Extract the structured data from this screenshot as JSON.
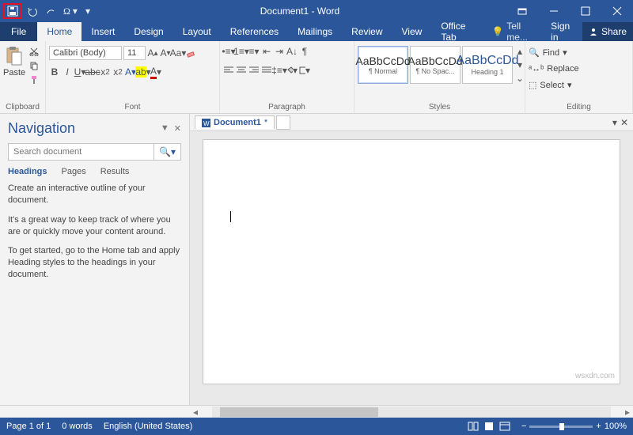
{
  "titlebar": {
    "title": "Document1 - Word"
  },
  "tabs": {
    "file": "File",
    "items": [
      "Home",
      "Insert",
      "Design",
      "Layout",
      "References",
      "Mailings",
      "Review",
      "View",
      "Office Tab"
    ],
    "active": "Home",
    "tell": "Tell me...",
    "signin": "Sign in",
    "share": "Share"
  },
  "ribbon": {
    "clipboard": {
      "paste": "Paste",
      "label": "Clipboard"
    },
    "font": {
      "name": "Calibri (Body)",
      "size": "11",
      "label": "Font"
    },
    "paragraph": {
      "label": "Paragraph"
    },
    "styles": {
      "preview": "AaBbCcDd",
      "items": [
        {
          "name": "¶ Normal"
        },
        {
          "name": "¶ No Spac..."
        },
        {
          "name": "Heading 1"
        }
      ],
      "label": "Styles"
    },
    "editing": {
      "find": "Find",
      "replace": "Replace",
      "select": "Select",
      "label": "Editing"
    }
  },
  "nav": {
    "title": "Navigation",
    "search_placeholder": "Search document",
    "tabs": [
      "Headings",
      "Pages",
      "Results"
    ],
    "active_tab": "Headings",
    "p1": "Create an interactive outline of your document.",
    "p2": "It's a great way to keep track of where you are or quickly move your content around.",
    "p3": "To get started, go to the Home tab and apply Heading styles to the headings in your document."
  },
  "doctab": {
    "name": "Document1",
    "star": "*"
  },
  "status": {
    "page": "Page 1 of 1",
    "words": "0 words",
    "lang": "English (United States)",
    "zoom": "100%"
  },
  "watermark": "wsxdn.com"
}
